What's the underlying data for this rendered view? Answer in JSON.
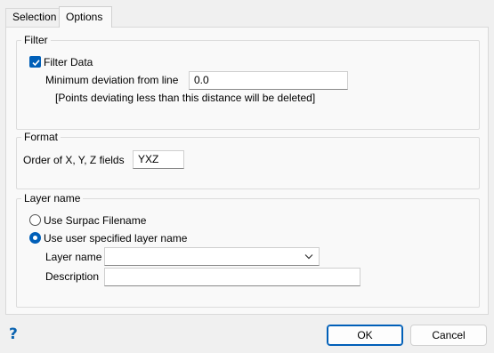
{
  "tabs": [
    {
      "label": "Selection",
      "active": false
    },
    {
      "label": "Options",
      "active": true
    }
  ],
  "filter": {
    "title": "Filter",
    "checkbox_label": "Filter Data",
    "checked": true,
    "min_deviation_label": "Minimum deviation from line",
    "min_deviation_value": "0.0",
    "note": "[Points deviating less than this distance will be deleted]"
  },
  "format": {
    "title": "Format",
    "order_label": "Order of X, Y, Z fields",
    "order_value": "YXZ"
  },
  "layer": {
    "title": "Layer name",
    "radio_surpac_label": "Use Surpac Filename",
    "radio_user_label": "Use user specified layer name",
    "selected": "user",
    "layer_name_label": "Layer name",
    "layer_name_value": "",
    "description_label": "Description",
    "description_value": ""
  },
  "footer": {
    "help_glyph": "?",
    "ok_label": "OK",
    "cancel_label": "Cancel"
  },
  "colors": {
    "accent": "#005fb8",
    "help": "#0a63b0"
  }
}
